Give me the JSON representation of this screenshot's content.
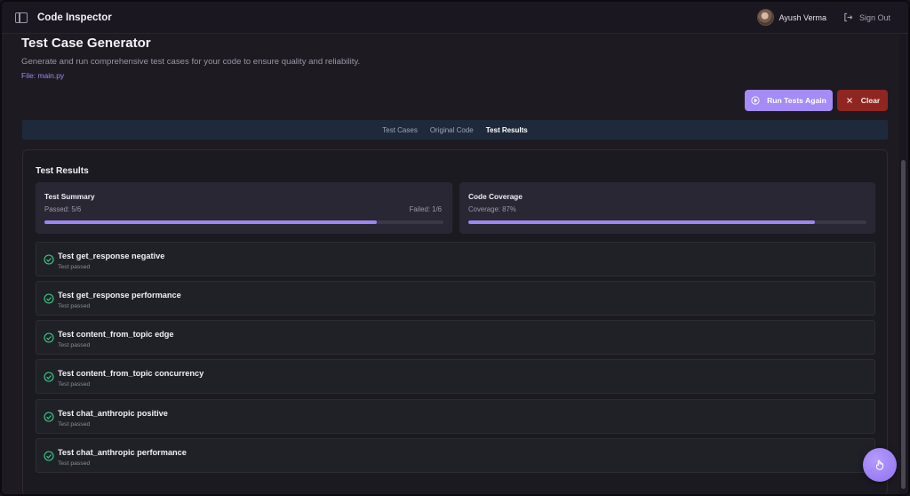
{
  "header": {
    "app_title": "Code Inspector",
    "user_name": "Ayush Verma",
    "signout_label": "Sign Out"
  },
  "page": {
    "title": "Test Case Generator",
    "description": "Generate and run comprehensive test cases for your code to ensure quality and reliability.",
    "file_label": "File: main.py"
  },
  "actions": {
    "run_label": "Run Tests Again",
    "clear_label": "Clear"
  },
  "tabs": [
    {
      "label": "Test Cases",
      "active": false
    },
    {
      "label": "Original Code",
      "active": false
    },
    {
      "label": "Test Results",
      "active": true
    }
  ],
  "results": {
    "title": "Test Results",
    "summary": {
      "title": "Test Summary",
      "passed_label": "Passed: 5/6",
      "failed_label": "Failed: 1/6",
      "progress": 0.833
    },
    "coverage": {
      "title": "Code Coverage",
      "coverage_label": "Coverage: 87%",
      "progress": 0.87
    },
    "tests": [
      {
        "name": "Test get_response negative",
        "status": "Test passed"
      },
      {
        "name": "Test get_response performance",
        "status": "Test passed"
      },
      {
        "name": "Test content_from_topic edge",
        "status": "Test passed"
      },
      {
        "name": "Test content_from_topic concurrency",
        "status": "Test passed"
      },
      {
        "name": "Test chat_anthropic positive",
        "status": "Test passed"
      },
      {
        "name": "Test chat_anthropic performance",
        "status": "Test passed"
      }
    ]
  },
  "colors": {
    "accent": "#a48bf6",
    "danger": "#8f2621",
    "success": "#3ecf8e"
  }
}
